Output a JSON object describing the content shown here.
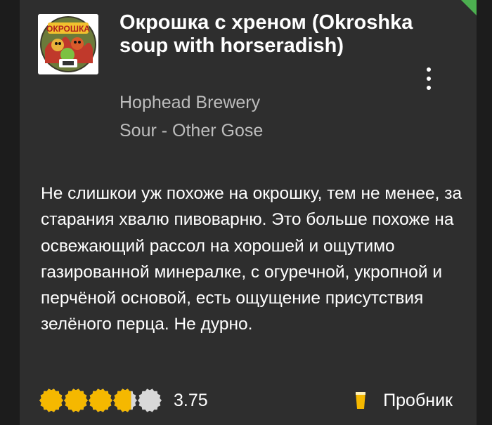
{
  "checkin": {
    "beer_name": "Окрошка с хреном (Okroshka soup with horseradish)",
    "brewery": "Hophead Brewery",
    "style": "Sour - Other Gose",
    "label_logo_text": "ОКРОШКА",
    "review": "Не слишкои уж похоже на окрошку, тем не менее, за старания хвалю пивоварню. Это больше похоже на освежающий рассол на хорошей и ощутимо газированной минералке, с огуречной, укропной и перчёной основой, есть ощущение присутствия зелёного перца. Не дурно.",
    "rating": {
      "value": "3.75",
      "score": 3.75,
      "max": 5
    },
    "serving": {
      "label": "Пробник",
      "icon": "taster-glass-icon"
    },
    "menu_icon": "more-vertical-icon",
    "badge_icon": "checkmark-corner-icon"
  },
  "colors": {
    "background": "#2e2e2e",
    "text_primary": "#ffffff",
    "text_secondary": "#bdbdbd",
    "rating_filled": "#f5b800",
    "rating_empty": "#d8d8d8",
    "badge": "#4caf50"
  }
}
